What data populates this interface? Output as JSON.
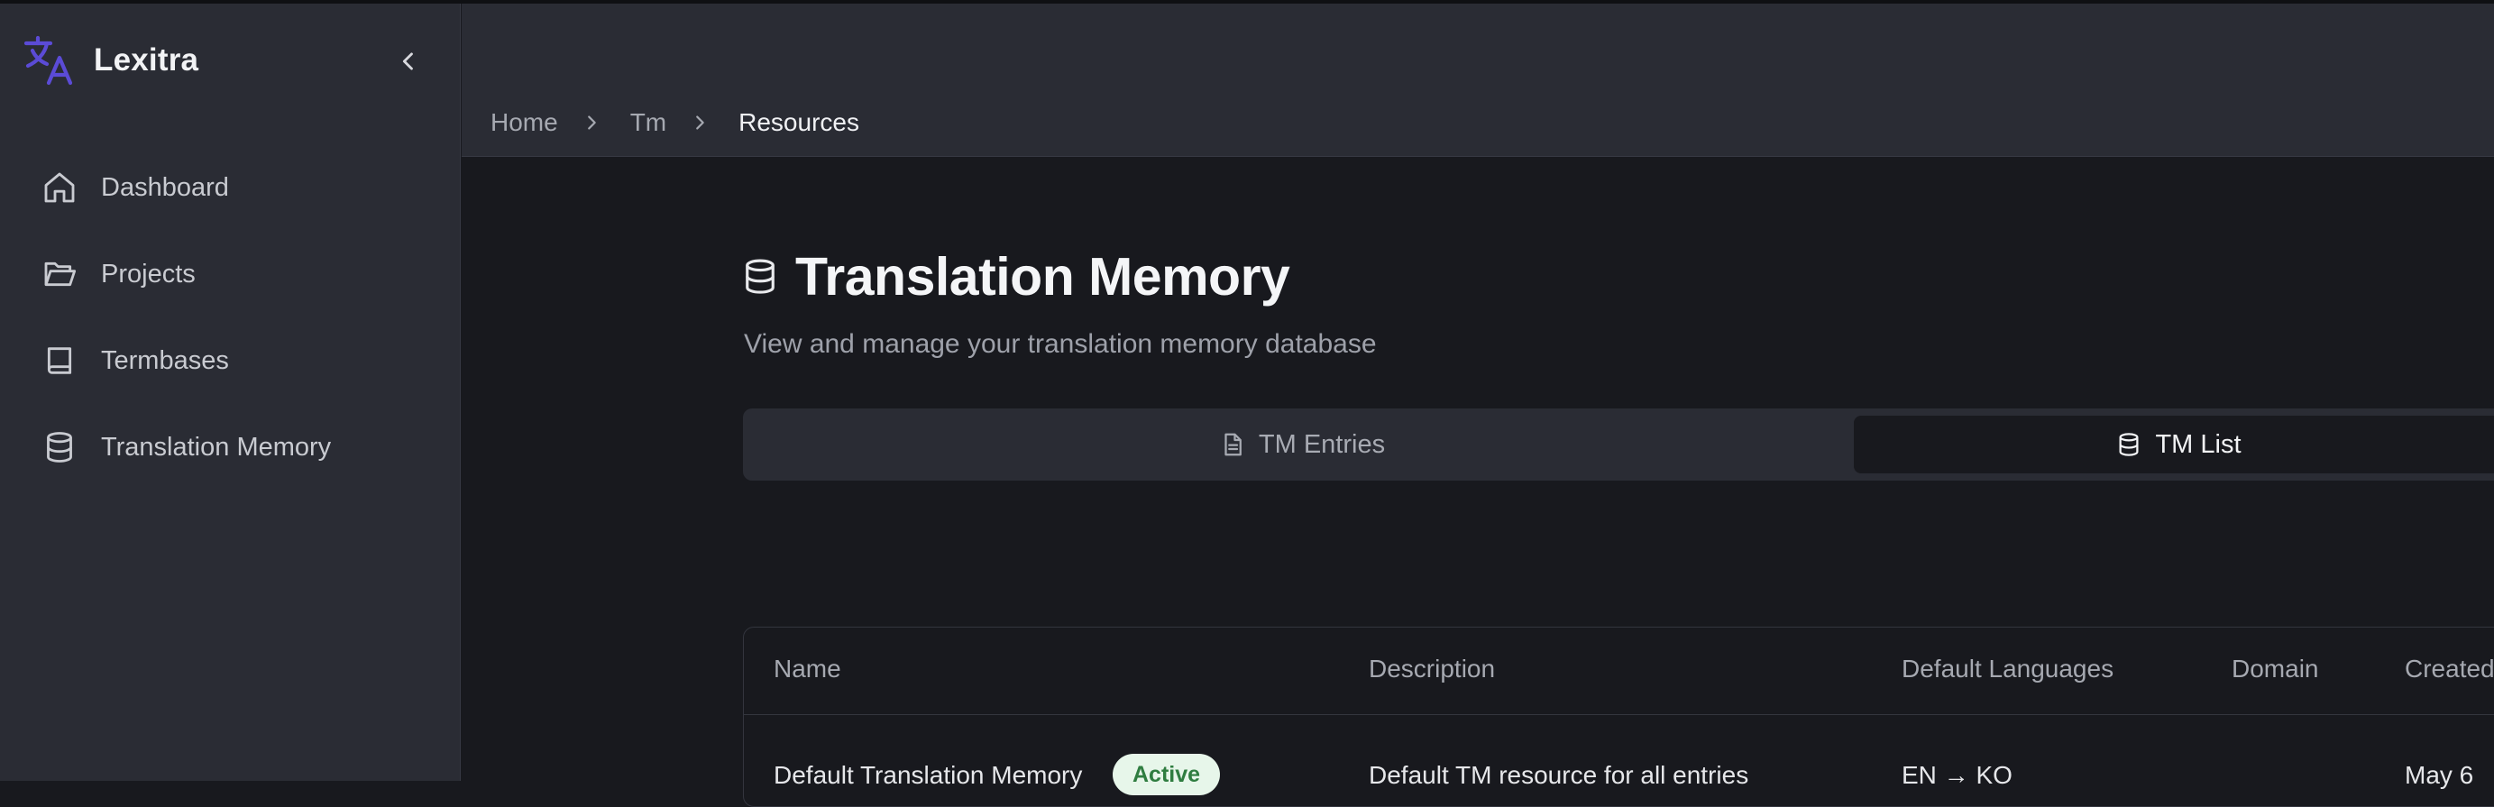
{
  "app": {
    "name": "Lexitra"
  },
  "sidebar": {
    "items": [
      {
        "label": "Dashboard",
        "icon": "home-icon"
      },
      {
        "label": "Projects",
        "icon": "folder-open-icon"
      },
      {
        "label": "Termbases",
        "icon": "book-icon"
      },
      {
        "label": "Translation Memory",
        "icon": "database-icon"
      }
    ]
  },
  "breadcrumb": {
    "home": "Home",
    "tm": "Tm",
    "current": "Resources"
  },
  "page": {
    "title": "Translation Memory",
    "subtitle": "View and manage your translation memory database"
  },
  "tabs": {
    "entries": "TM Entries",
    "list": "TM List",
    "selected": "TM List"
  },
  "table": {
    "headers": [
      "Name",
      "Description",
      "Default Languages",
      "Domain",
      "Created"
    ],
    "rows": [
      {
        "name": "Default Translation Memory",
        "status": "Active",
        "description": "Default TM resource for all entries",
        "languages": "EN → KO",
        "domain": "",
        "created": "May 6"
      }
    ]
  },
  "colors": {
    "accent": "#5b4bd6",
    "active_badge_bg": "#e7f6ea",
    "active_badge_text": "#2f7d40"
  }
}
